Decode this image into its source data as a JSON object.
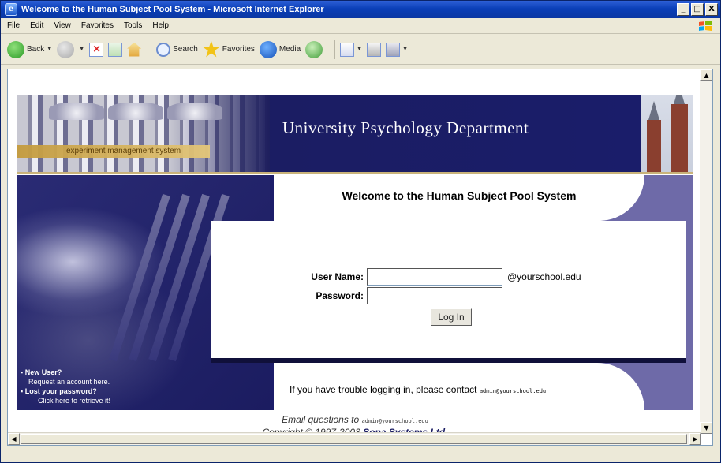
{
  "window": {
    "title": "Welcome to the Human Subject Pool System - Microsoft Internet Explorer",
    "controls": {
      "minimize": "_",
      "maximize": "□",
      "close": "X"
    }
  },
  "menu": [
    "File",
    "Edit",
    "View",
    "Favorites",
    "Tools",
    "Help"
  ],
  "toolbar": {
    "back": "Back",
    "search": "Search",
    "favorites": "Favorites",
    "media": "Media"
  },
  "banner": {
    "ems": "experiment management system",
    "department": "University Psychology Department"
  },
  "welcome": "Welcome to the Human Subject Pool System",
  "login": {
    "username_label": "User Name:",
    "username_value": "",
    "username_suffix": "@yourschool.edu",
    "password_label": "Password:",
    "password_value": "",
    "button": "Log In"
  },
  "trouble": {
    "text": "If you have trouble logging in, please contact",
    "email": "admin@yourschool.edu"
  },
  "sidebar": {
    "new_user": "New User?",
    "request": "Request an account here.",
    "lost": "Lost your password?",
    "retrieve": "Click here to retrieve it!"
  },
  "footer": {
    "email_prefix": "Email questions to",
    "email": "admin@yourschool.edu",
    "copyright": "Copyright © 1997-2003",
    "company": "Sona Systems Ltd."
  },
  "colors": {
    "banner_navy": "#1e1f5e",
    "panel_purple": "#6e6aa8",
    "title_blue": "#0a3fb8"
  }
}
